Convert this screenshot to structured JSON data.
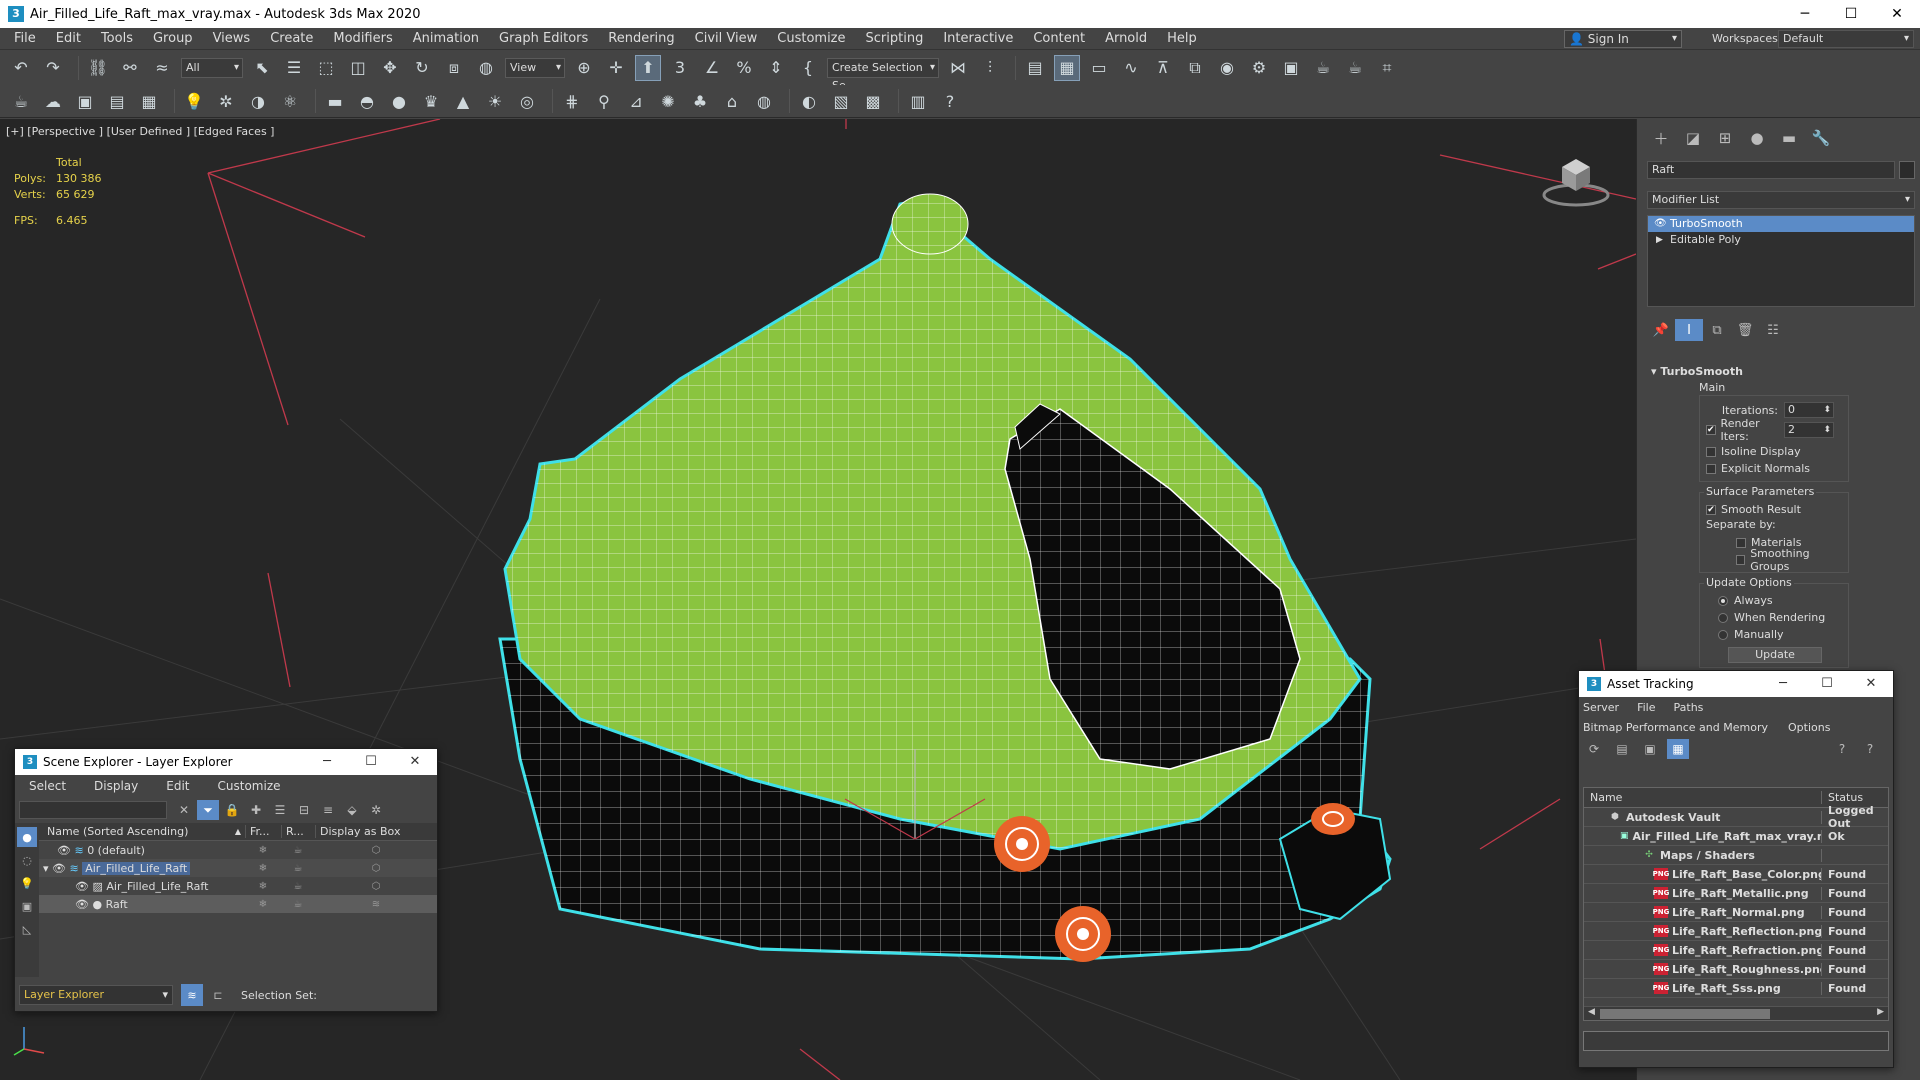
{
  "window": {
    "title": "Air_Filled_Life_Raft_max_vray.max - Autodesk 3ds Max 2020",
    "minimize": "─",
    "maximize": "☐",
    "close": "✕"
  },
  "menu": {
    "items": [
      "File",
      "Edit",
      "Tools",
      "Group",
      "Views",
      "Create",
      "Modifiers",
      "Animation",
      "Graph Editors",
      "Rendering",
      "Civil View",
      "Customize",
      "Scripting",
      "Interactive",
      "Content",
      "Arnold",
      "Help"
    ],
    "sign_in": "Sign In",
    "workspaces_label": "Workspaces:",
    "workspace_value": "Default"
  },
  "toolbar": {
    "selection_filter": "All",
    "ref_coord": "View",
    "create_selection": "Create Selection Se"
  },
  "viewport": {
    "label": "[+] [Perspective ] [User Defined ] [Edged Faces ]",
    "stats": {
      "total_label": "Total",
      "polys_label": "Polys:",
      "polys_value": "130 386",
      "verts_label": "Verts:",
      "verts_value": "65 629",
      "fps_label": "FPS:",
      "fps_value": "6.465"
    }
  },
  "command_panel": {
    "object_name": "Raft",
    "modifier_list": "Modifier List",
    "stack": [
      {
        "label": "TurboSmooth",
        "selected": true
      },
      {
        "label": "Editable Poly",
        "selected": false
      }
    ],
    "turbosmooth": {
      "title": "TurboSmooth",
      "main_label": "Main",
      "iterations_label": "Iterations:",
      "iterations_value": "0",
      "render_iters_label": "Render Iters:",
      "render_iters_value": "2",
      "isoline_display": "Isoline Display",
      "explicit_normals": "Explicit Normals",
      "surface_params_label": "Surface Parameters",
      "smooth_result": "Smooth Result",
      "separate_by": "Separate by:",
      "materials": "Materials",
      "smoothing_groups": "Smoothing Groups",
      "update_options_label": "Update Options",
      "always": "Always",
      "when_rendering": "When Rendering",
      "manually": "Manually",
      "update_button": "Update"
    }
  },
  "scene_explorer": {
    "title": "Scene Explorer - Layer Explorer",
    "menu": [
      "Select",
      "Display",
      "Edit",
      "Customize"
    ],
    "columns": {
      "name": "Name (Sorted Ascending)",
      "frozen": "Fr...",
      "render": "R...",
      "display_as_box": "Display as Box"
    },
    "rows": [
      {
        "name": "0 (default)",
        "indent": 0
      },
      {
        "name": "Air_Filled_Life_Raft",
        "indent": 0
      },
      {
        "name": "Air_Filled_Life_Raft",
        "indent": 1
      },
      {
        "name": "Raft",
        "indent": 1
      }
    ],
    "layer_explorer": "Layer Explorer",
    "selection_set_label": "Selection Set:"
  },
  "asset_tracking": {
    "title": "Asset Tracking",
    "menu1": [
      "Server",
      "File",
      "Paths"
    ],
    "menu2": [
      "Bitmap Performance and Memory",
      "Options"
    ],
    "columns": {
      "name": "Name",
      "status": "Status"
    },
    "rows": [
      {
        "name": "Autodesk Vault",
        "status": "Logged Out",
        "icon": "vault"
      },
      {
        "name": "Air_Filled_Life_Raft_max_vray.max",
        "status": "Ok",
        "icon": "file"
      },
      {
        "name": "Maps / Shaders",
        "status": "",
        "icon": "maps"
      },
      {
        "name": "Life_Raft_Base_Color.png",
        "status": "Found",
        "icon": "png"
      },
      {
        "name": "Life_Raft_Metallic.png",
        "status": "Found",
        "icon": "png"
      },
      {
        "name": "Life_Raft_Normal.png",
        "status": "Found",
        "icon": "png"
      },
      {
        "name": "Life_Raft_Reflection.png",
        "status": "Found",
        "icon": "png"
      },
      {
        "name": "Life_Raft_Refraction.png",
        "status": "Found",
        "icon": "png"
      },
      {
        "name": "Life_Raft_Roughness.png",
        "status": "Found",
        "icon": "png"
      },
      {
        "name": "Life_Raft_Sss.png",
        "status": "Found",
        "icon": "png"
      }
    ]
  },
  "colors": {
    "raft_green": "#8ac43f",
    "selection_outline": "#3fe0e8",
    "stats_yellow": "#e6d24a",
    "selection_blue": "#5b8bc7",
    "orange": "#e8632a"
  }
}
